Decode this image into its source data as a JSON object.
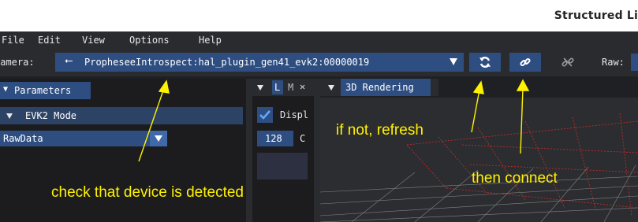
{
  "window": {
    "title": "Structured Li"
  },
  "menu": {
    "items": [
      "File",
      "Edit",
      "View",
      "Options",
      "Help"
    ]
  },
  "toolbar": {
    "camera_label": "Camera:",
    "camera_value": "PropheseeIntrospect:hal_plugin_gen41_evk2:00000019",
    "raw_label": "Raw:",
    "buttons": [
      "refresh-icon",
      "connect-link-icon",
      "disconnect-link-icon"
    ]
  },
  "parameters_panel": {
    "tab_label": "Parameters",
    "section_label": "EVK2 Mode",
    "mode_value": "RawData"
  },
  "mid_panel": {
    "tab_labels": [
      "L",
      "M"
    ],
    "display_label": "Displ",
    "value": "128",
    "value_suffix": "C"
  },
  "render_panel": {
    "tab_label": "3D Rendering"
  },
  "annotations": {
    "device_check": "check that device is detected",
    "refresh": "if not, refresh",
    "connect": "then connect"
  },
  "colors": {
    "accent": "#2e4e82",
    "annotation": "#fff200",
    "background": "#1f2023"
  }
}
